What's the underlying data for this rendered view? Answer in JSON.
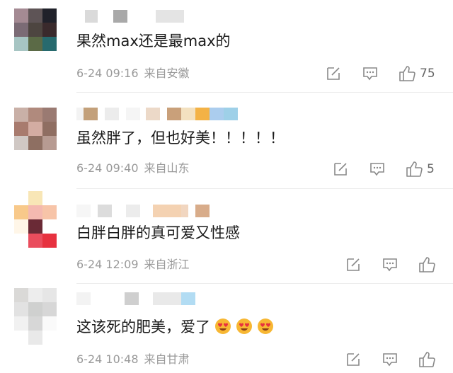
{
  "comments": [
    {
      "text": "果然max还是最max的",
      "date": "6-24 09:16",
      "location": "来自安徽",
      "likes": "75",
      "avatar_colors": [
        "#a48a93",
        "#5e5456",
        "#20212a",
        "#7b6b75",
        "#4d4540",
        "#3a2a2c",
        "#a7c5c3",
        "#5b6a46",
        "#276a6e"
      ],
      "name_colors": [
        "#d2d2d2",
        "#a9a9a9",
        "#e2e2e2"
      ]
    },
    {
      "text": "虽然胖了，但也好美！！！！！",
      "date": "6-24 09:40",
      "location": "来自山东",
      "likes": "5",
      "avatar_colors": [
        "#c9b0a7",
        "#b08a7d",
        "#9a7a72",
        "#a87b6e",
        "#d3aca2",
        "#8f6e62",
        "#d0c8c4",
        "#8e6f62",
        "#b79b92"
      ],
      "name_colors": [
        "#f3f3f3",
        "#c3a07a",
        "#ececec",
        "#f5f5f5",
        "#ecd9c8",
        "#c9a07a",
        "#f3e1c0",
        "#f3b246",
        "#abcdee",
        "#9ed0e8"
      ]
    },
    {
      "text": "白胖白胖的真可爱又性感",
      "date": "6-24 12:09",
      "location": "来自浙江",
      "likes": "",
      "avatar_colors": [
        "#ffffff",
        "#f8e6b6",
        "#ffffff",
        "#f8c98a",
        "#f4b9b0",
        "#f7c4a8",
        "#ffffff",
        "#6a2a36",
        "#ffffff"
      ],
      "name_colors": [
        "#f1f1f1",
        "#dcdcdc",
        "#ececec",
        "#f4d2b2",
        "#f1d6c0",
        "#d8ac8a"
      ],
      "avatar_extra": [
        "#ea4d5d",
        "#e7313f"
      ]
    },
    {
      "text": "这该死的肥美，爱了",
      "date": "6-24 10:48",
      "location": "来自甘肃",
      "likes": "",
      "avatar_colors": [
        "#dad9d7",
        "#ededed",
        "#e6e6e6",
        "#e2e2e2",
        "#cfd0cf",
        "#d7d7d7",
        "#f1f1f1",
        "#d7d7d7",
        "#fafafa"
      ],
      "name_colors": [
        "#f3f3f3",
        "#cfcfcf",
        "#e9e9e9",
        "#b2dcf3"
      ],
      "emojis": [
        "heart-eyes-face",
        "heart-eyes-face",
        "heart-eyes-face"
      ]
    }
  ],
  "icons": {
    "edit": "edit-icon",
    "comment": "comment-icon",
    "like": "thumbs-up-icon"
  }
}
